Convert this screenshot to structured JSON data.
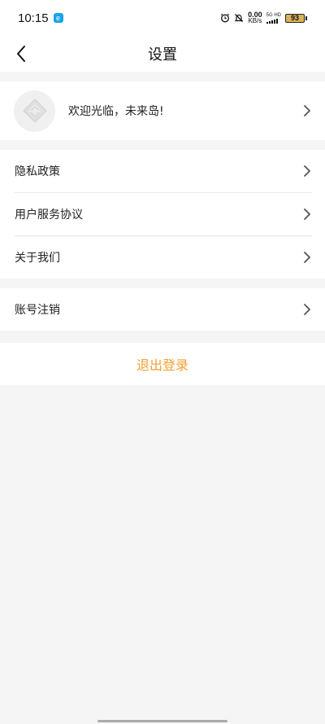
{
  "status_bar": {
    "time": "10:15",
    "net_speed_value": "0.00",
    "net_speed_unit": "KB/s",
    "network_type": "5G HD",
    "battery": "93"
  },
  "header": {
    "title": "设置"
  },
  "profile": {
    "welcome_text": "欢迎光临，未来岛!"
  },
  "menu_group_1": [
    {
      "label": "隐私政策"
    },
    {
      "label": "用户服务协议"
    },
    {
      "label": "关于我们"
    }
  ],
  "menu_group_2": [
    {
      "label": "账号注销"
    }
  ],
  "logout": {
    "label": "退出登录"
  },
  "colors": {
    "accent": "#f0a030",
    "background": "#f5f5f5",
    "card": "#ffffff",
    "battery": "#d8b25a"
  },
  "icons": {
    "back": "chevron-left-icon",
    "row_arrow": "chevron-right-icon",
    "alarm": "alarm-icon",
    "mute": "bell-off-icon",
    "avatar": "default-avatar-icon",
    "app": "app-badge-icon"
  }
}
